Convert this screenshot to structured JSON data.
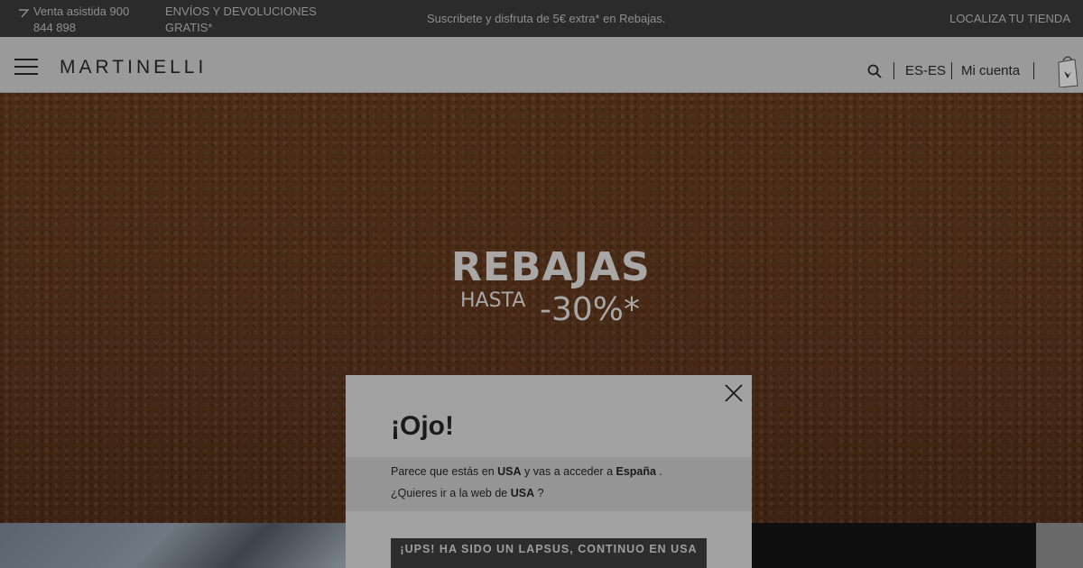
{
  "topbar": {
    "phone_label": "Venta asistida 900 844 898",
    "shipping_label": "ENVÍOS Y DEVOLUCIONES GRATIS*",
    "promo_label": "Suscribete y disfruta de 5€ extra* en Rebajas.",
    "store_label": "LOCALIZA TU TIENDA"
  },
  "header": {
    "logo": "MARTINELLI",
    "language": "ES-ES",
    "account": "Mi cuenta"
  },
  "hero": {
    "title": "REBAJAS",
    "upto": "HASTA",
    "discount": "-30%*"
  },
  "modal": {
    "title": "¡Ojo!",
    "line1_prefix": "Parece que estás en",
    "line1_country": "USA",
    "line1_middle": "y vas a acceder a",
    "line1_target": "España",
    "line1_suffix": ".",
    "line2_prefix": "¿Quieres ir a la web de",
    "line2_country": "USA",
    "line2_suffix": "?",
    "button_label": "¡UPS! HA SIDO UN LAPSUS, CONTINUO EN USA"
  },
  "colors": {
    "topbar_bg": "#2b2b2b",
    "overlay_header": "#9a9a9a",
    "modal_bg": "#a2a2a2",
    "button_bg": "#2d2d2d"
  }
}
